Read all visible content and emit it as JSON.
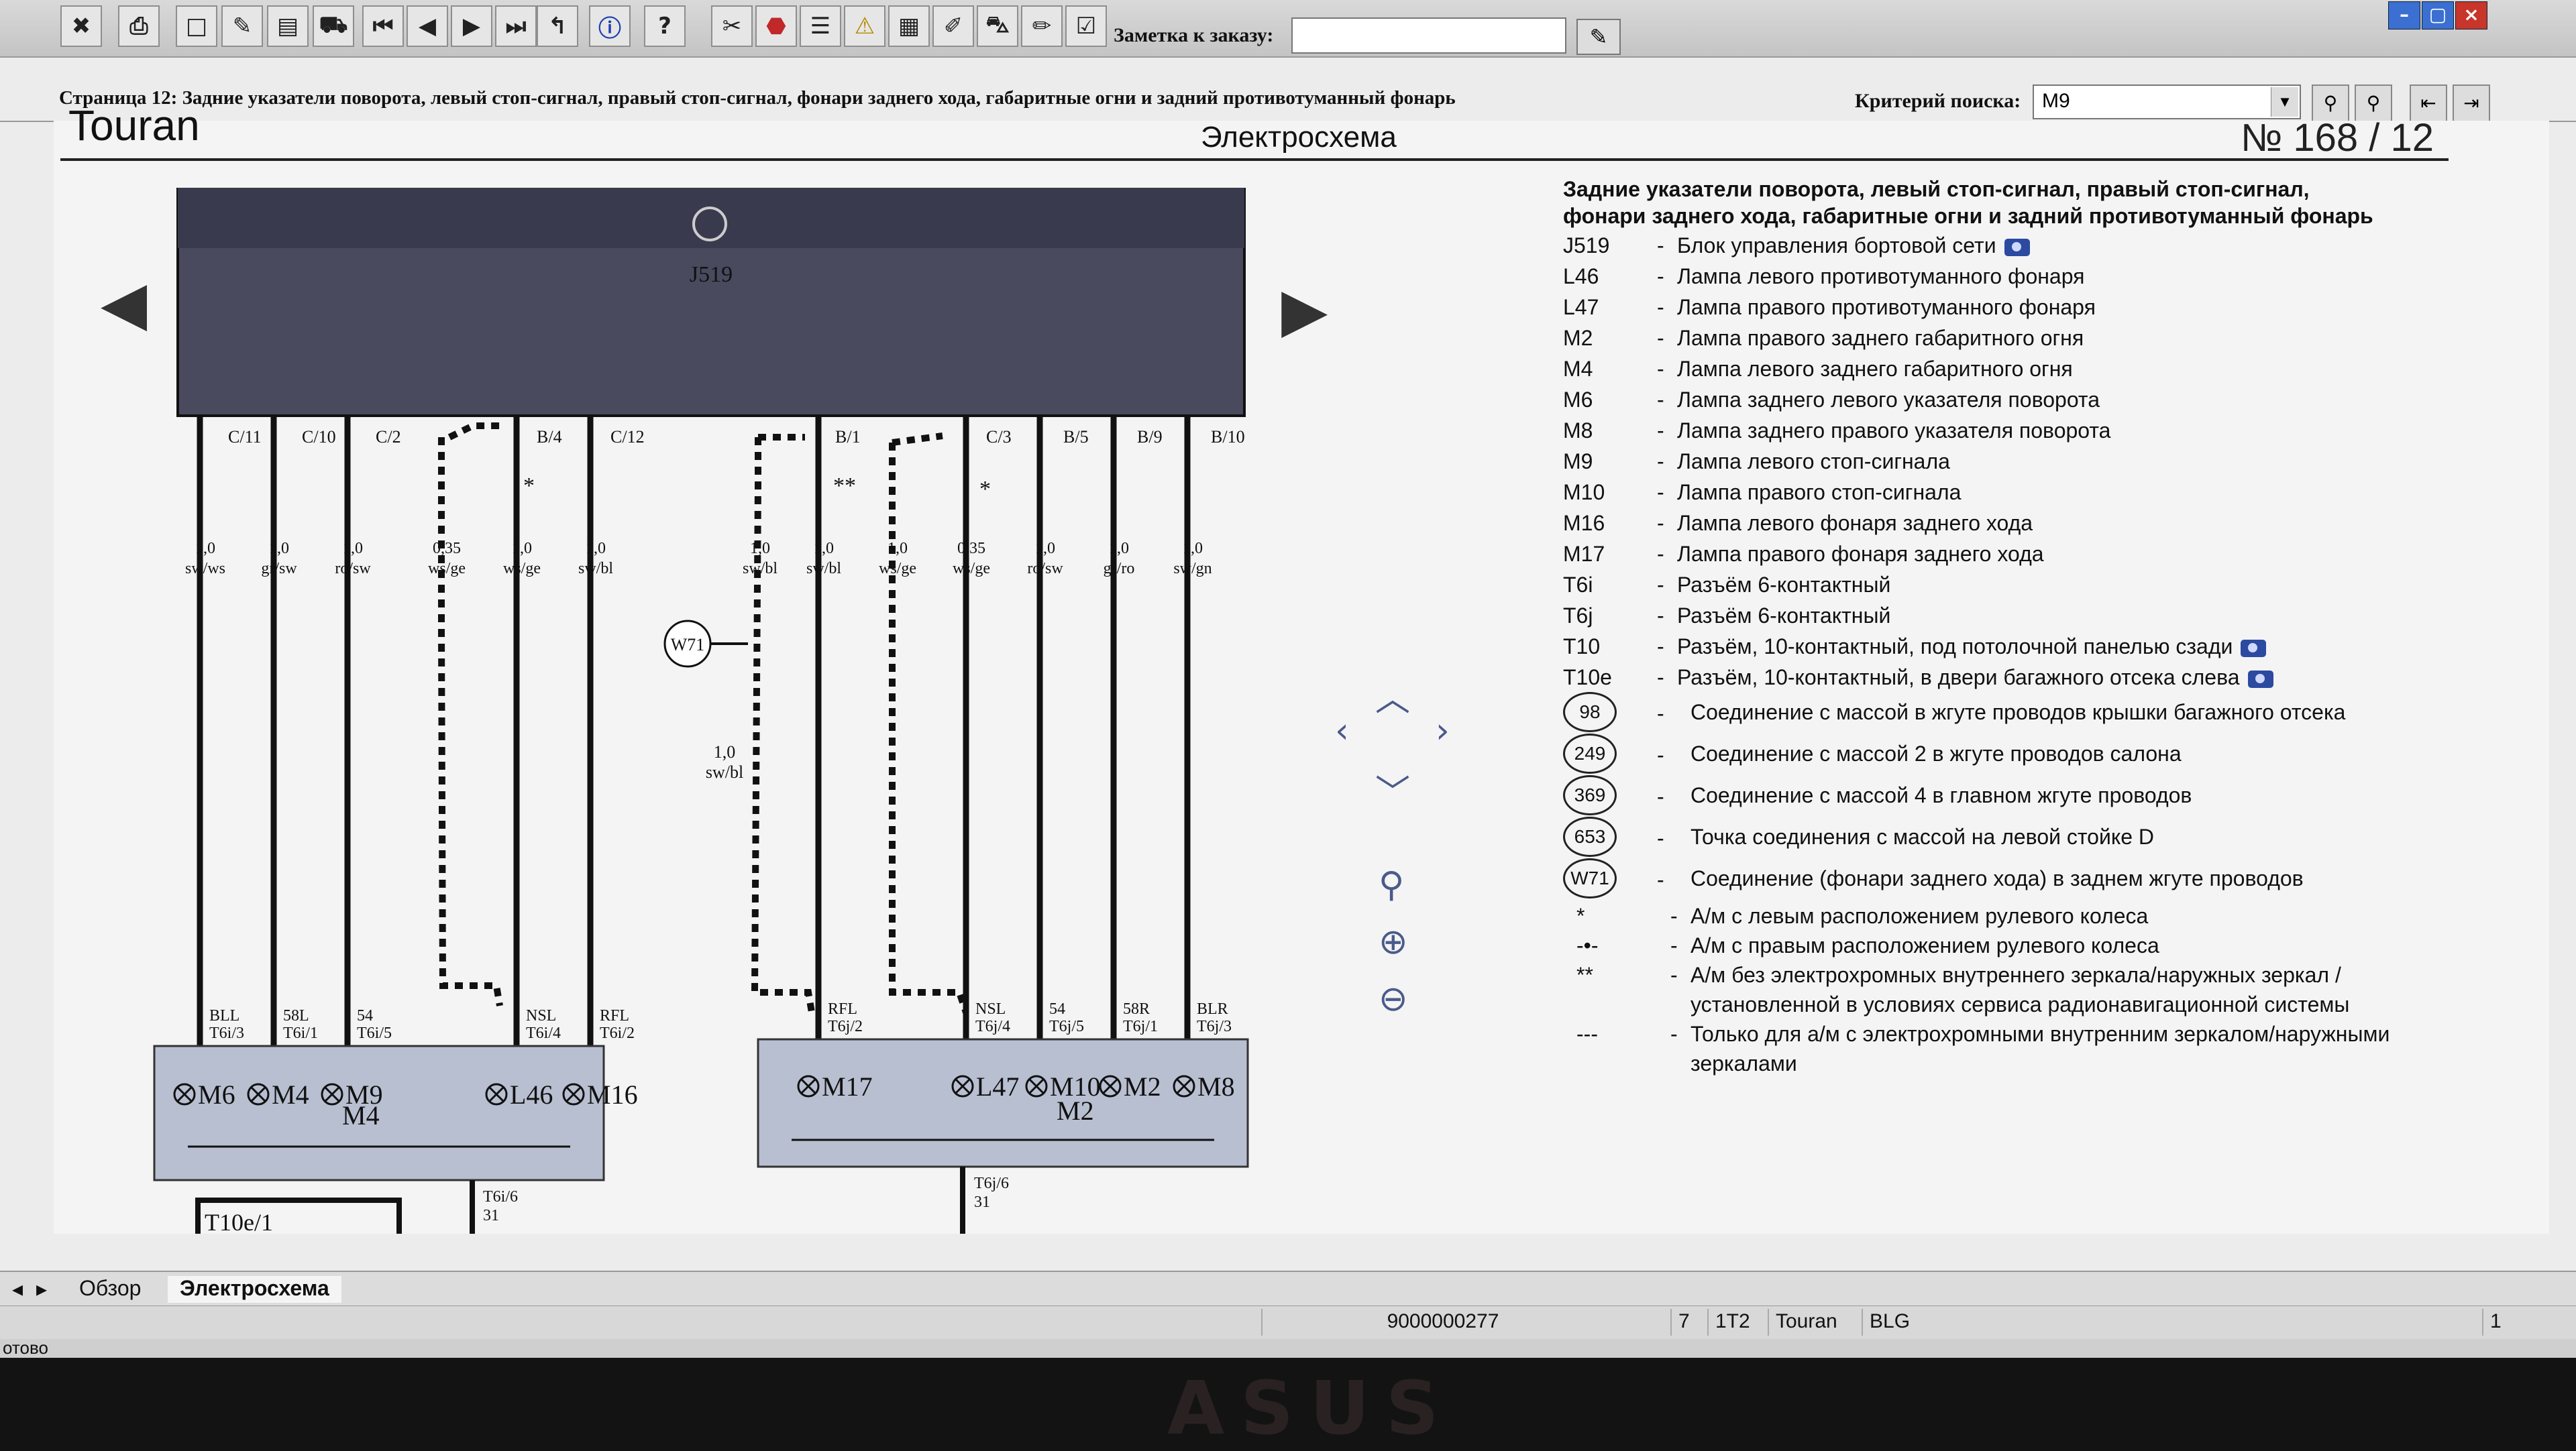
{
  "toolbar": {
    "order_note_label": "Заметка к заказу:",
    "order_note_value": "",
    "buttons": [
      "exit-icon",
      "print-icon",
      "new-doc-icon",
      "edit-icon",
      "clipboard-icon",
      "car-icon",
      "first-page-icon",
      "prev-page-icon",
      "next-page-icon",
      "last-page-icon",
      "back-icon",
      "info-icon",
      "help-icon",
      "tools-icon",
      "stop-icon",
      "list-icon",
      "warning-icon",
      "calendar-icon",
      "pen-icon",
      "car-side-icon",
      "pencil-icon",
      "checklist-icon"
    ]
  },
  "page_bar": {
    "title": "Страница 12: Задние указатели поворота, левый стоп-сигнал, правый стоп-сигнал, фонари заднего хода, габаритные огни и задний противотуманный фонарь",
    "search_label": "Критерий поиска:",
    "search_value": "M9"
  },
  "document": {
    "brand": "Touran",
    "kind": "Электросхема",
    "number": "№  168 / 12"
  },
  "diagram": {
    "control_unit": "J519",
    "top_pins": [
      "C/11",
      "C/10",
      "C/2",
      "B/4",
      "C/12",
      "B/1",
      "C/3",
      "B/5",
      "B/9",
      "B/10"
    ],
    "wire_specs": [
      {
        "size": "1,0",
        "color": "sw/ws"
      },
      {
        "size": "1,0",
        "color": "gr/sw"
      },
      {
        "size": "1,0",
        "color": "ro/sw"
      },
      {
        "size": "0,35",
        "color": "ws/ge"
      },
      {
        "size": "1,0",
        "color": "ws/ge"
      },
      {
        "size": "1,0",
        "color": "sw/bl"
      },
      {
        "size": "1,0",
        "color": "sw/bl"
      },
      {
        "size": "1,0",
        "color": "sw/bl"
      },
      {
        "size": "1,0",
        "color": "ws/ge"
      },
      {
        "size": "0,35",
        "color": "ws/ge"
      },
      {
        "size": "1,0",
        "color": "ro/sw"
      },
      {
        "size": "1,0",
        "color": "gr/ro"
      },
      {
        "size": "1,0",
        "color": "sw/gn"
      }
    ],
    "middle_wire": {
      "size": "1,0",
      "color": "sw/bl"
    },
    "marker_star": "*",
    "marker_double_star": "**",
    "ground_node": "W71",
    "left_signals": [
      {
        "name": "BLL",
        "pin": "T6i/3"
      },
      {
        "name": "58L",
        "pin": "T6i/1"
      },
      {
        "name": "54",
        "pin": "T6i/5"
      },
      {
        "name": "NSL",
        "pin": "T6i/4"
      },
      {
        "name": "RFL",
        "pin": "T6i/2"
      }
    ],
    "right_signals": [
      {
        "name": "RFL",
        "pin": "T6j/2"
      },
      {
        "name": "NSL",
        "pin": "T6j/4"
      },
      {
        "name": "54",
        "pin": "T6j/5"
      },
      {
        "name": "58R",
        "pin": "T6j/1"
      },
      {
        "name": "BLR",
        "pin": "T6j/3"
      }
    ],
    "left_lamps": [
      "M6",
      "M4",
      "M9",
      "L46",
      "M16"
    ],
    "left_lamp_sub": "M4",
    "right_lamps": [
      "M17",
      "L47",
      "M10",
      "M2",
      "M8"
    ],
    "right_lamp_sub": "M2",
    "left_ground_pin": "T6i/6",
    "right_ground_pin": "T6j/6",
    "ground_number": "31",
    "connector_bottom": "T10e/1"
  },
  "legend": {
    "title_line1": "Задние указатели поворота, левый стоп-сигнал, правый стоп-сигнал,",
    "title_line2": "фонари заднего хода, габаритные огни и задний противотуманный фонарь",
    "items": [
      {
        "code": "J519",
        "text": "Блок управления бортовой сети",
        "camera": true
      },
      {
        "code": "L46",
        "text": "Лампа левого противотуманного фонаря"
      },
      {
        "code": "L47",
        "text": "Лампа правого противотуманного фонаря"
      },
      {
        "code": "M2",
        "text": "Лампа правого заднего габаритного огня"
      },
      {
        "code": "M4",
        "text": "Лампа левого заднего габаритного огня"
      },
      {
        "code": "M6",
        "text": "Лампа заднего левого указателя поворота"
      },
      {
        "code": "M8",
        "text": "Лампа заднего правого указателя поворота"
      },
      {
        "code": "M9",
        "text": "Лампа левого стоп-сигнала"
      },
      {
        "code": "M10",
        "text": "Лампа правого стоп-сигнала"
      },
      {
        "code": "M16",
        "text": "Лампа левого фонаря заднего хода"
      },
      {
        "code": "M17",
        "text": "Лампа правого фонаря заднего хода"
      },
      {
        "code": "T6i",
        "text": "Разъём 6-контактный"
      },
      {
        "code": "T6j",
        "text": "Разъём 6-контактный"
      },
      {
        "code": "T10",
        "text": "Разъём, 10-контактный, под потолочной панелью сзади",
        "camera": true
      },
      {
        "code": "T10e",
        "text": "Разъём, 10-контактный, в двери багажного отсека слева",
        "camera": true
      }
    ],
    "grounds": [
      {
        "code": "98",
        "text": "Соединение с массой в жгуте проводов крышки багажного отсека"
      },
      {
        "code": "249",
        "text": "Соединение с массой 2 в жгуте проводов салона"
      },
      {
        "code": "369",
        "text": "Соединение с массой 4 в главном жгуте проводов"
      },
      {
        "code": "653",
        "text": "Точка соединения с массой на левой стойке D"
      },
      {
        "code": "W71",
        "text": "Соединение (фонари заднего хода) в заднем жгуте проводов"
      }
    ],
    "notes": [
      {
        "mark": "*",
        "text": "А/м с левым расположением рулевого колеса"
      },
      {
        "mark": "-•-",
        "text": "А/м с правым расположением рулевого колеса"
      },
      {
        "mark": "**",
        "text": "А/м без электрохромных внутреннего зеркала/наружных зеркал /"
      },
      {
        "mark": "",
        "text": "установленной в условиях сервиса радионавигационной системы"
      },
      {
        "mark": "---",
        "text": "Только для а/м с электрохромными внутренним зеркалом/наружными"
      },
      {
        "mark": "",
        "text": "зеркалами"
      }
    ]
  },
  "tabs": {
    "overview": "Обзор",
    "schematic": "Электросхема"
  },
  "status": {
    "document_id": "9000000277",
    "cell_a": "7",
    "cell_b": "1T2",
    "cell_model": "Touran",
    "cell_code": "BLG",
    "page_no": "1",
    "ready": "отово"
  },
  "bezel": {
    "brand": "ASUS"
  }
}
